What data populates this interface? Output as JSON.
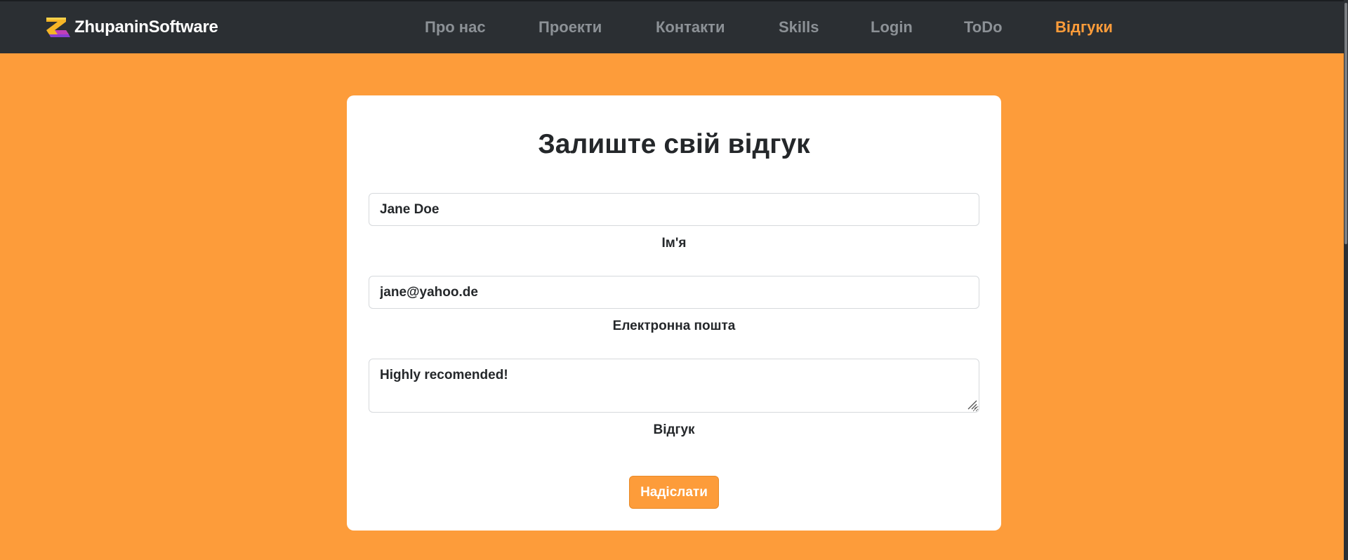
{
  "brand": {
    "name": "ZhupaninSoftware",
    "logo_icon": "brand-logo-icon"
  },
  "nav": {
    "items": [
      {
        "label": "Про нас",
        "active": false
      },
      {
        "label": "Проекти",
        "active": false
      },
      {
        "label": "Контакти",
        "active": false
      },
      {
        "label": "Skills",
        "active": false
      },
      {
        "label": "Login",
        "active": false
      },
      {
        "label": "ToDo",
        "active": false
      },
      {
        "label": "Відгуки",
        "active": true
      }
    ]
  },
  "form": {
    "title": "Залиште свій відгук",
    "name": {
      "value": "Jane Doe",
      "label": "Ім'я"
    },
    "email": {
      "value": "jane@yahoo.de",
      "label": "Електронна пошта"
    },
    "review": {
      "value": "Highly recomended!",
      "label": "Відгук"
    },
    "submit_label": "Надіслати"
  },
  "colors": {
    "page_background": "#fd9c3a",
    "navbar_background": "#2b2f33",
    "accent": "#fd9c3a",
    "nav_inactive": "#8c9196",
    "text_dark": "#24272a"
  }
}
